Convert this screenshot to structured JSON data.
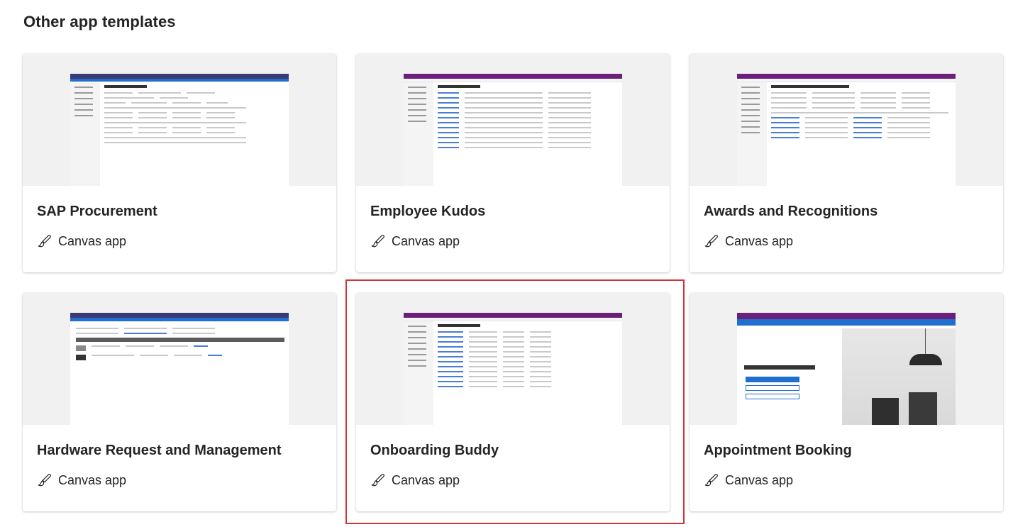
{
  "section": {
    "title": "Other app templates"
  },
  "cards": [
    {
      "title": "SAP Procurement",
      "type": "Canvas app"
    },
    {
      "title": "Employee Kudos",
      "type": "Canvas app"
    },
    {
      "title": "Awards and Recognitions",
      "type": "Canvas app"
    },
    {
      "title": "Hardware Request and Management",
      "type": "Canvas app"
    },
    {
      "title": "Onboarding Buddy",
      "type": "Canvas app"
    },
    {
      "title": "Appointment Booking",
      "type": "Canvas app"
    }
  ],
  "selected_card": "Onboarding Buddy",
  "colors": {
    "selection": "#d13438",
    "preview_bg": "#f1f1f1",
    "powerapps_purple": "#6a1f7a"
  },
  "icons": {
    "type_icon": "paintbrush-icon"
  }
}
